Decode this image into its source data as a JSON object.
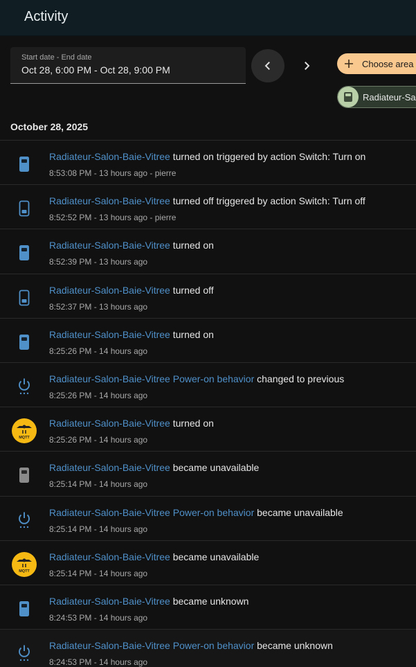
{
  "header": {
    "title": "Activity"
  },
  "date_picker": {
    "label": "Start date - End date",
    "value": "Oct 28, 6:00 PM - Oct 28, 9:00 PM"
  },
  "controls": {
    "prev_icon": "chevron-left-icon",
    "next_icon": "chevron-right-icon",
    "choose_area": "Choose area",
    "entity_chip": "Radiateur-Salon-Baie-Vitree"
  },
  "day_header": "October 28, 2025",
  "colors": {
    "accent_blue": "#4f90c9",
    "area_chip": "#f9c88f",
    "mqtt": "#f6b914"
  },
  "entries": [
    {
      "icon": "switch-on-icon",
      "entity": "Radiateur-Salon-Baie-Vitree",
      "message": " turned on triggered by action Switch: Turn on",
      "meta": "8:53:08 PM - 13 hours ago - pierre"
    },
    {
      "icon": "switch-off-icon",
      "entity": "Radiateur-Salon-Baie-Vitree",
      "message": " turned off triggered by action Switch: Turn off",
      "meta": "8:52:52 PM - 13 hours ago - pierre"
    },
    {
      "icon": "switch-on-icon",
      "entity": "Radiateur-Salon-Baie-Vitree",
      "message": " turned on",
      "meta": "8:52:39 PM - 13 hours ago"
    },
    {
      "icon": "switch-off-icon",
      "entity": "Radiateur-Salon-Baie-Vitree",
      "message": " turned off",
      "meta": "8:52:37 PM - 13 hours ago"
    },
    {
      "icon": "switch-on-icon",
      "entity": "Radiateur-Salon-Baie-Vitree",
      "message": " turned on",
      "meta": "8:25:26 PM - 14 hours ago"
    },
    {
      "icon": "power-settings-icon",
      "entity": "Radiateur-Salon-Baie-Vitree Power-on behavior",
      "message": " changed to previous",
      "meta": "8:25:26 PM - 14 hours ago"
    },
    {
      "icon": "mqtt-icon",
      "entity": "Radiateur-Salon-Baie-Vitree",
      "message": " turned on",
      "meta": "8:25:26 PM - 14 hours ago"
    },
    {
      "icon": "switch-unavailable-icon",
      "entity": "Radiateur-Salon-Baie-Vitree",
      "message": " became unavailable",
      "meta": "8:25:14 PM - 14 hours ago"
    },
    {
      "icon": "power-settings-icon",
      "entity": "Radiateur-Salon-Baie-Vitree Power-on behavior",
      "message": " became unavailable",
      "meta": "8:25:14 PM - 14 hours ago"
    },
    {
      "icon": "mqtt-icon",
      "entity": "Radiateur-Salon-Baie-Vitree",
      "message": " became unavailable",
      "meta": "8:25:14 PM - 14 hours ago"
    },
    {
      "icon": "switch-on-icon",
      "entity": "Radiateur-Salon-Baie-Vitree",
      "message": " became unknown",
      "meta": "8:24:53 PM - 14 hours ago"
    },
    {
      "icon": "power-settings-icon",
      "entity": "Radiateur-Salon-Baie-Vitree Power-on behavior",
      "message": " became unknown",
      "meta": "8:24:53 PM - 14 hours ago"
    }
  ]
}
